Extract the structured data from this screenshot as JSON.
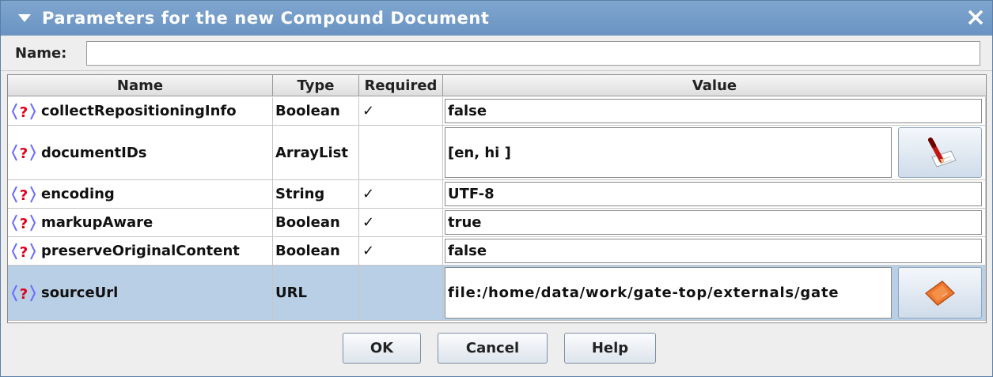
{
  "dialog": {
    "title": "Parameters for the new Compound Document",
    "name_label": "Name:",
    "name_value": "",
    "colors": {
      "titlebar": "#7099c8",
      "selected_row": "#b8cfe5",
      "help_icon": "#e0001b"
    }
  },
  "table": {
    "headers": {
      "name": "Name",
      "type": "Type",
      "required": "Required",
      "value": "Value"
    },
    "rows": [
      {
        "icon": "help-icon",
        "name": "collectRepositioningInfo",
        "type": "Boolean",
        "required": "✓",
        "value": "false"
      },
      {
        "icon": "help-icon",
        "name": "documentIDs",
        "type": "ArrayList",
        "required": "",
        "value": "[en, hi ]",
        "button_icon": "edit-list-icon"
      },
      {
        "icon": "help-icon",
        "name": "encoding",
        "type": "String",
        "required": "✓",
        "value": "UTF-8"
      },
      {
        "icon": "help-icon",
        "name": "markupAware",
        "type": "Boolean",
        "required": "✓",
        "value": "true"
      },
      {
        "icon": "help-icon",
        "name": "preserveOriginalContent",
        "type": "Boolean",
        "required": "✓",
        "value": "false"
      },
      {
        "icon": "help-icon",
        "name": "sourceUrl",
        "type": "URL",
        "required": "",
        "value": "file:/home/data/work/gate-top/externals/gate",
        "button_icon": "open-file-icon",
        "selected": true
      }
    ]
  },
  "buttons": {
    "ok": "OK",
    "cancel": "Cancel",
    "help": "Help"
  }
}
